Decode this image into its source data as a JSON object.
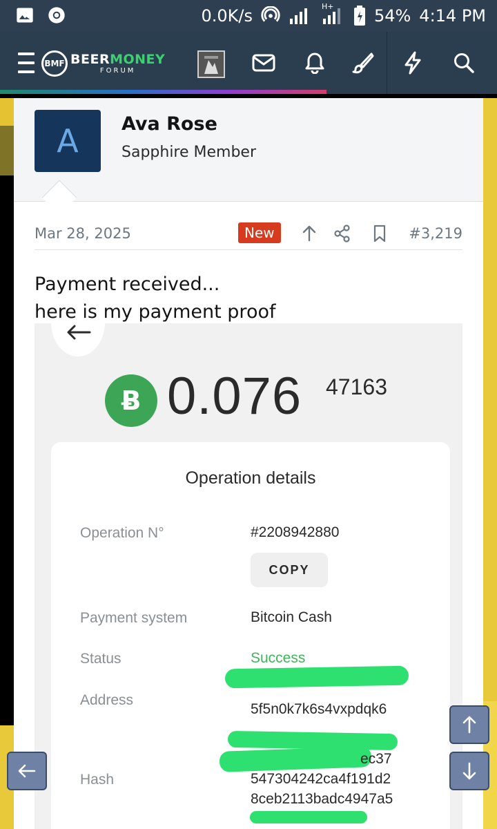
{
  "status_bar": {
    "network_speed": "0.0K/s",
    "network_type": "H+",
    "battery": "54%",
    "time": "4:14 PM",
    "icons": [
      "image-icon",
      "chrome-icon",
      "hotspot-icon",
      "signal-icon",
      "signal-icon",
      "battery-icon"
    ]
  },
  "navbar": {
    "logo_word1": "BEER",
    "logo_word2": "MONEY",
    "logo_sub": "FORUM",
    "logo_mark": "BMF",
    "icons": [
      "menu-icon",
      "mail-icon",
      "bell-icon",
      "brush-icon",
      "bolt-icon",
      "search-icon"
    ],
    "colors": {
      "bar": "#2b3e50",
      "logo_accent": "#3bd16f"
    }
  },
  "post": {
    "avatar_letter": "A",
    "username": "Ava Rose",
    "user_title": "Sapphire Member",
    "date": "Mar 28, 2025",
    "badge": "New",
    "post_number": "#3,219",
    "message_line1": "Payment received...",
    "message_line2": "here is my payment proof"
  },
  "proof": {
    "coin_symbol": "Ƀ",
    "amount_main": "0.076",
    "amount_small": "47163",
    "details_title": "Operation details",
    "operation_label": "Operation N°",
    "operation_value": "#2208942880",
    "copy_label": "COPY",
    "payment_system_label": "Payment system",
    "payment_system_value": "Bitcoin Cash",
    "status_label": "Status",
    "status_value": "Success",
    "address_label": "Address",
    "address_value": "5f5n0k7k6s4vxpdqk6",
    "hash_label": "Hash",
    "hash_line1": "ec37",
    "hash_line2": "547304242ca4f191d2",
    "hash_line3": "8ceb2113badc4947a5",
    "colors": {
      "success": "#3fb55c",
      "coin": "#3da556",
      "redaction": "#2ee06f"
    }
  }
}
